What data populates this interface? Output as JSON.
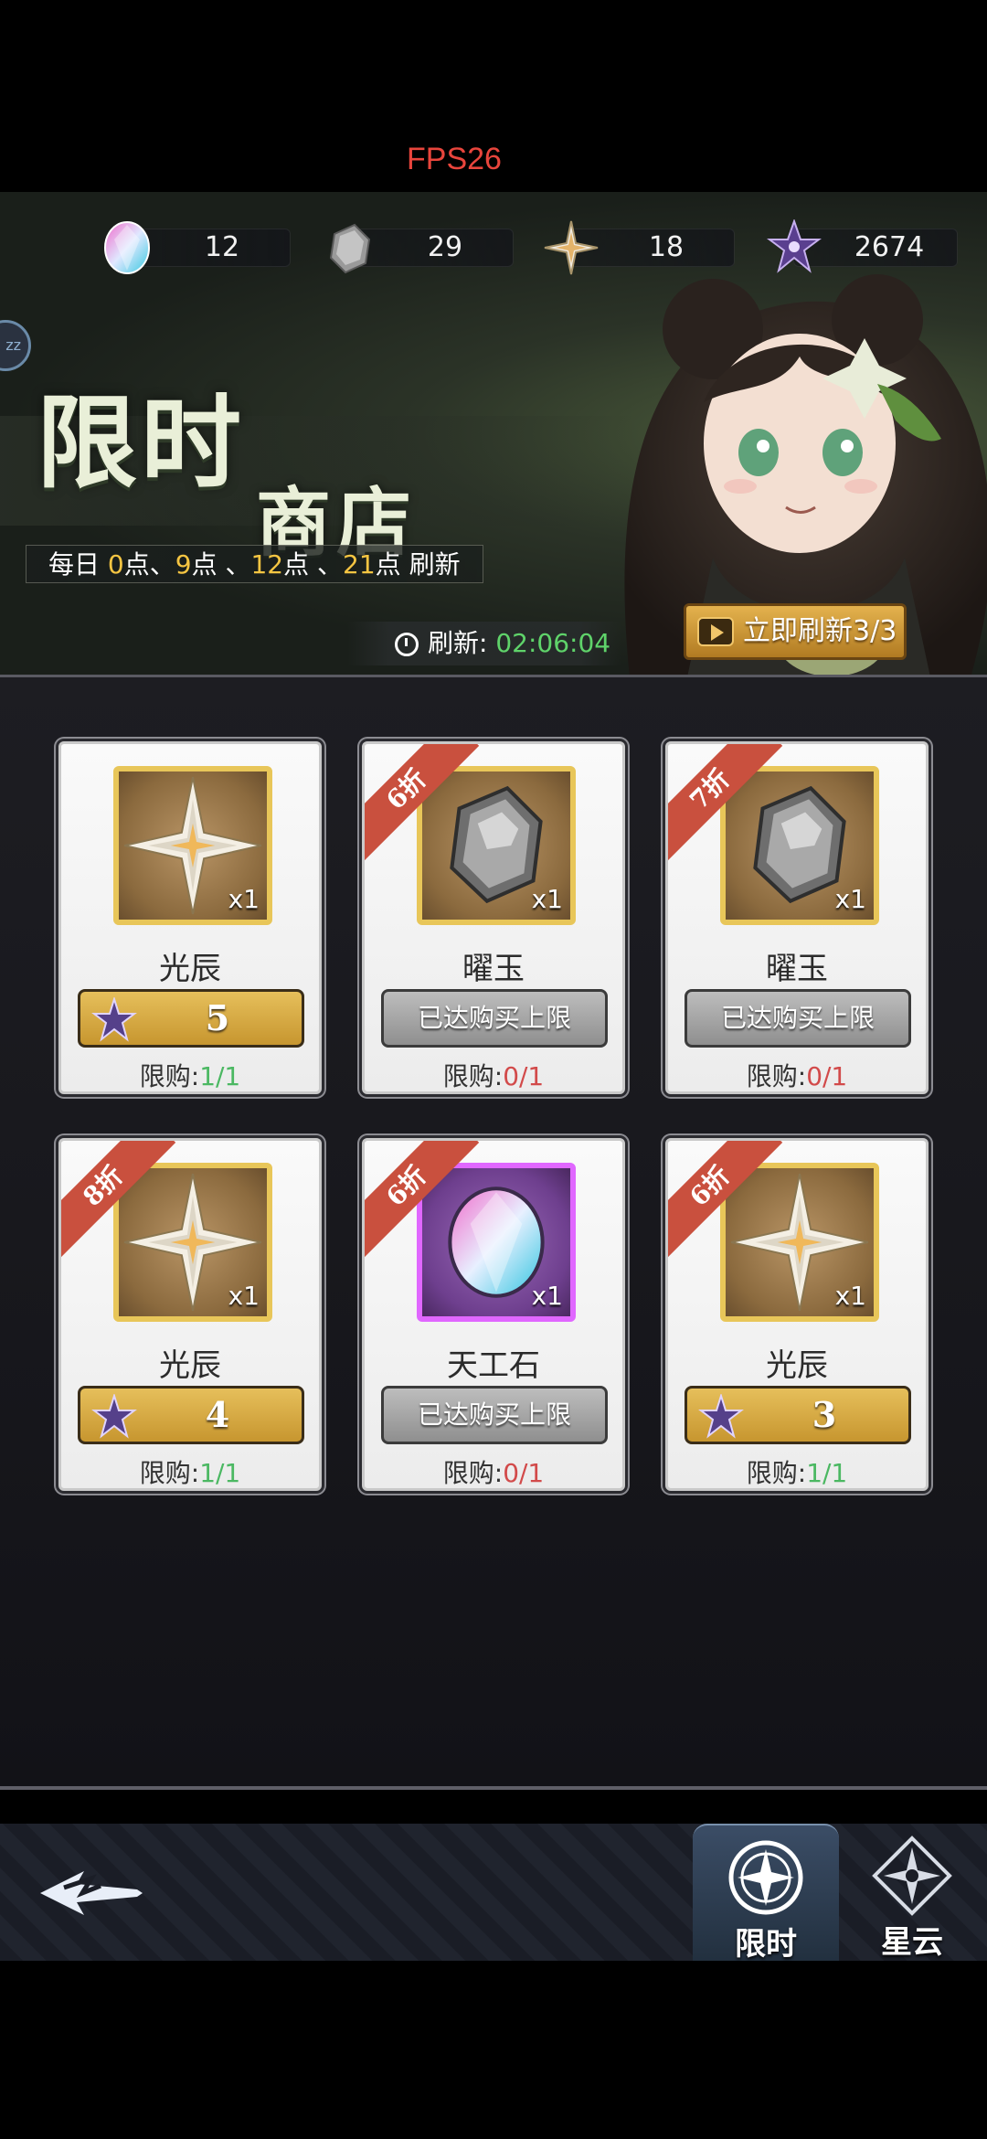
{
  "status": {
    "fps": "FPS26"
  },
  "currencies": [
    {
      "icon": "rainbow-gem-icon",
      "value": "12"
    },
    {
      "icon": "gray-stone-icon",
      "value": "29"
    },
    {
      "icon": "silver-star-icon",
      "value": "18"
    },
    {
      "icon": "purple-star-icon",
      "value": "2674"
    }
  ],
  "banner": {
    "title_line1": "限时",
    "title_line2": "商店",
    "refresh_times": {
      "prefix": "每日 ",
      "t1": "0",
      "u1": "点、",
      "t2": "9",
      "u2": "点 、",
      "t3": "12",
      "u3": "点 、",
      "t4": "21",
      "u4": "点 刷新"
    },
    "countdown_label": "刷新: ",
    "countdown_time": "02:06:04",
    "refresh_button": "立即刷新3/3",
    "side_badge": "zz"
  },
  "items": [
    {
      "name": "光辰",
      "qty": "x1",
      "icon": "silver-star-icon",
      "discount": "",
      "state": "buy",
      "price": "5",
      "limit_label": "限购:",
      "limit_value": "1/1",
      "limit_color": "green"
    },
    {
      "name": "曜玉",
      "qty": "x1",
      "icon": "gray-stone-icon",
      "discount": "6折",
      "state": "sold",
      "sold_label": "已达购买上限",
      "limit_label": "限购:",
      "limit_value": "0/1",
      "limit_color": "red"
    },
    {
      "name": "曜玉",
      "qty": "x1",
      "icon": "gray-stone-icon",
      "discount": "7折",
      "state": "sold",
      "sold_label": "已达购买上限",
      "limit_label": "限购:",
      "limit_value": "0/1",
      "limit_color": "red"
    },
    {
      "name": "光辰",
      "qty": "x1",
      "icon": "silver-star-icon",
      "discount": "8折",
      "state": "buy",
      "price": "4",
      "limit_label": "限购:",
      "limit_value": "1/1",
      "limit_color": "green"
    },
    {
      "name": "天工石",
      "qty": "x1",
      "icon": "rainbow-gem-icon",
      "discount": "6折",
      "state": "sold",
      "sold_label": "已达购买上限",
      "limit_label": "限购:",
      "limit_value": "0/1",
      "limit_color": "red"
    },
    {
      "name": "光辰",
      "qty": "x1",
      "icon": "silver-star-icon",
      "discount": "6折",
      "state": "buy",
      "price": "3",
      "limit_label": "限购:",
      "limit_value": "1/1",
      "limit_color": "green"
    }
  ],
  "nav": {
    "back_icon": "back-arrow-icon",
    "tabs": [
      {
        "label": "限时",
        "icon": "compass-icon",
        "active": true
      },
      {
        "label": "星云",
        "icon": "nebula-star-icon",
        "active": false
      }
    ]
  }
}
